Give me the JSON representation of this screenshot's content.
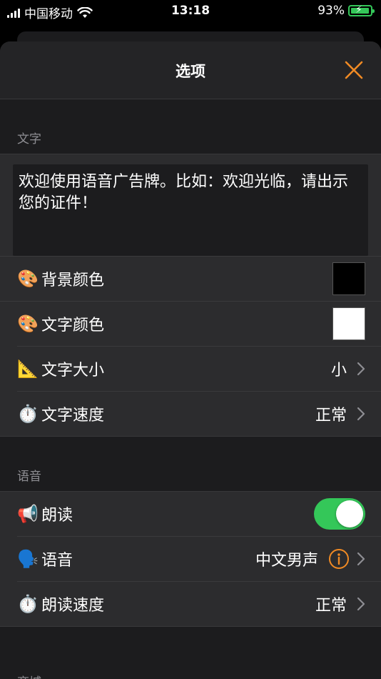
{
  "status_bar": {
    "carrier": "中国移动",
    "time": "13:18",
    "battery_percent": "93%",
    "icons": [
      "signal-icon",
      "wifi-icon",
      "battery-charging-icon"
    ]
  },
  "nav": {
    "title": "选项",
    "close_icon": "close-icon"
  },
  "colors": {
    "accent": "#f08a24",
    "toggle_on": "#34c759",
    "background_color_value": "#000000",
    "text_color_value": "#ffffff"
  },
  "sections": {
    "text": {
      "header": "文字",
      "message": "欢迎使用语音广告牌。比如：欢迎光临，请出示您的证件！",
      "rows": {
        "background_color": {
          "icon": "🎨",
          "label": "背景颜色"
        },
        "text_color": {
          "icon": "🎨",
          "label": "文字颜色"
        },
        "text_size": {
          "icon": "📐",
          "label": "文字大小",
          "value": "小"
        },
        "text_speed": {
          "icon": "⏱️",
          "label": "文字速度",
          "value": "正常"
        }
      }
    },
    "voice": {
      "header": "语音",
      "rows": {
        "read_aloud": {
          "icon": "📢",
          "label": "朗读",
          "enabled": true
        },
        "voice": {
          "icon": "🗣️",
          "label": "语音",
          "value": "中文男声"
        },
        "read_speed": {
          "icon": "⏱️",
          "label": "朗读速度",
          "value": "正常"
        }
      }
    },
    "store": {
      "header": "商城"
    }
  }
}
